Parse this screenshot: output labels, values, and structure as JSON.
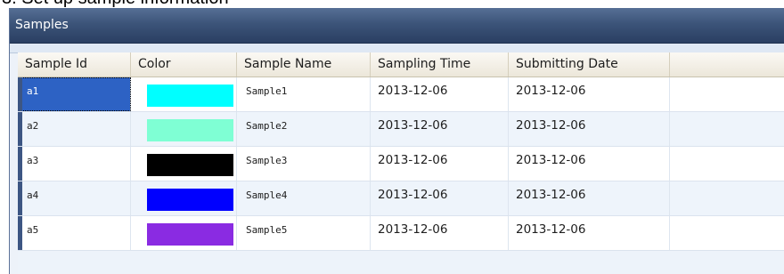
{
  "heading_fragment": "3. Set up sample information",
  "panel": {
    "title": "Samples"
  },
  "grid": {
    "columns": [
      "Sample Id",
      "Color",
      "Sample Name",
      "Sampling Time",
      "Submitting Date"
    ],
    "selected_row": 0,
    "rows": [
      {
        "id": "a1",
        "color": "#00ffff",
        "name": "Sample1",
        "sampling_time": "2013-12-06",
        "submitting_date": "2013-12-06"
      },
      {
        "id": "a2",
        "color": "#7fffd4",
        "name": "Sample2",
        "sampling_time": "2013-12-06",
        "submitting_date": "2013-12-06"
      },
      {
        "id": "a3",
        "color": "#000000",
        "name": "Sample3",
        "sampling_time": "2013-12-06",
        "submitting_date": "2013-12-06"
      },
      {
        "id": "a4",
        "color": "#0000ff",
        "name": "Sample4",
        "sampling_time": "2013-12-06",
        "submitting_date": "2013-12-06"
      },
      {
        "id": "a5",
        "color": "#8a2be2",
        "name": "Sample5",
        "sampling_time": "2013-12-06",
        "submitting_date": "2013-12-06"
      }
    ]
  }
}
